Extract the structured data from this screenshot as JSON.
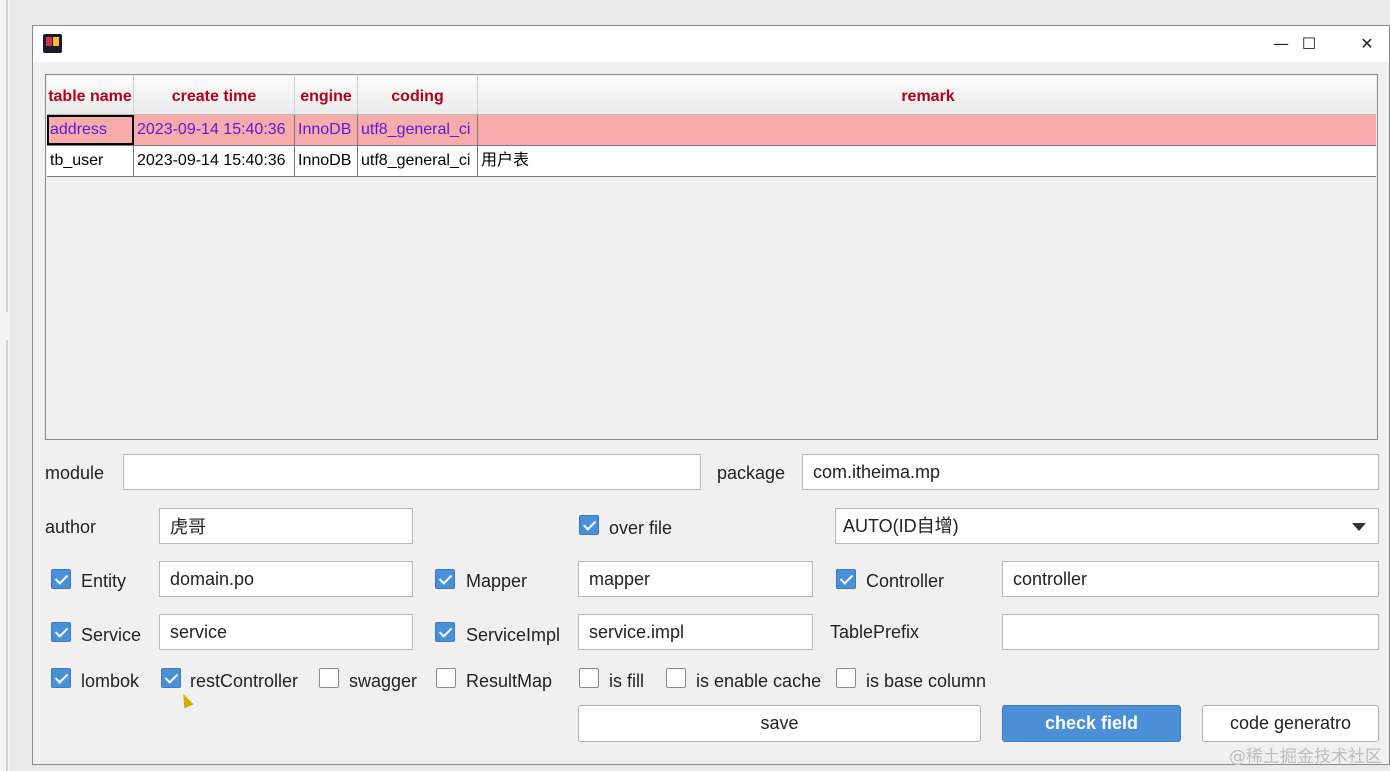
{
  "window": {
    "controls": {
      "minimize": "—",
      "maximize": "☐",
      "close": "✕"
    }
  },
  "table": {
    "columns": [
      "table name",
      "create time",
      "engine",
      "coding",
      "remark"
    ],
    "rows": [
      [
        "address",
        "2023-09-14 15:40:36",
        "InnoDB",
        "utf8_general_ci",
        ""
      ],
      [
        "tb_user",
        "2023-09-14 15:40:36",
        "InnoDB",
        "utf8_general_ci",
        "用户表"
      ]
    ],
    "selected_row": 0,
    "colors": {
      "header_text": "#b3001b",
      "selected_bg": "#f7abab",
      "selected_text": "#5b19d6"
    }
  },
  "form": {
    "module_label": "module",
    "module_value": "",
    "package_label": "package",
    "package_value": "com.itheima.mp",
    "author_label": "author",
    "author_value": "虎哥",
    "over_file_label": "over file",
    "over_file_checked": true,
    "id_type_selected": "AUTO(ID自增)",
    "entity_label": "Entity",
    "entity_checked": true,
    "entity_value": "domain.po",
    "mapper_label": "Mapper",
    "mapper_checked": true,
    "mapper_value": "mapper",
    "controller_label": "Controller",
    "controller_checked": true,
    "controller_value": "controller",
    "service_label": "Service",
    "service_checked": true,
    "service_value": "service",
    "serviceimpl_label": "ServiceImpl",
    "serviceimpl_checked": true,
    "serviceimpl_value": "service.impl",
    "tableprefix_label": "TablePrefix",
    "tableprefix_value": "",
    "lombok_label": "lombok",
    "lombok_checked": true,
    "restcontroller_label": "restController",
    "restcontroller_checked": true,
    "swagger_label": "swagger",
    "swagger_checked": false,
    "resultmap_label": "ResultMap",
    "resultmap_checked": false,
    "isfill_label": "is fill",
    "isfill_checked": false,
    "enablecache_label": "is enable cache",
    "enablecache_checked": false,
    "basecolumn_label": "is base column",
    "basecolumn_checked": false
  },
  "buttons": {
    "save": "save",
    "check_field": "check field",
    "code_generator": "code generatro"
  },
  "accent_color": "#4a90d9",
  "watermark": "@稀土掘金技术社区"
}
